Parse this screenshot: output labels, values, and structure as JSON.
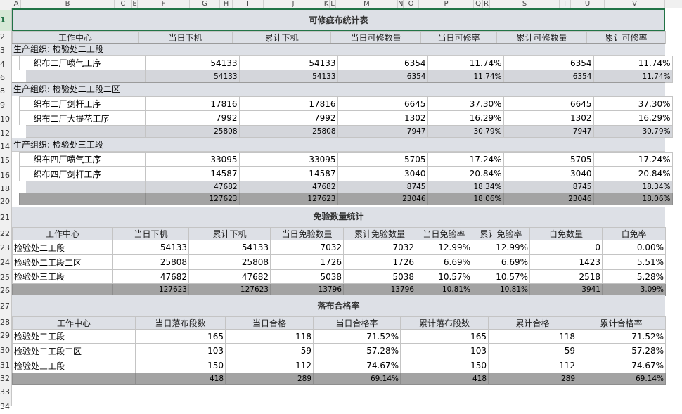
{
  "column_headers": [
    "A",
    "B",
    "C",
    "E",
    "F",
    "G",
    "H",
    "I",
    "J",
    "K",
    "L",
    "M",
    "N",
    "O",
    "P",
    "Q",
    "R",
    "S",
    "T",
    "U",
    "V"
  ],
  "row_headers": [
    "1",
    "2",
    "3",
    "4",
    "6",
    "8",
    "9",
    "10",
    "12",
    "14",
    "15",
    "16",
    "18",
    "20",
    "21",
    "22",
    "23",
    "24",
    "25",
    "26",
    "27",
    "28",
    "29",
    "30",
    "31",
    "32",
    "33",
    "34"
  ],
  "section1": {
    "title": "可修疵布统计表",
    "headers": [
      "工作中心",
      "当日下机",
      "累计下机",
      "当日可修数量",
      "当日可修率",
      "累计可修数量",
      "累计可修率"
    ],
    "groups": [
      {
        "label": "生产组织: 检验处二工段",
        "rows": [
          [
            "织布二厂喷气工序",
            "54133",
            "54133",
            "6354",
            "11.74%",
            "6354",
            "11.74%"
          ]
        ],
        "subtotal": [
          "",
          "54133",
          "54133",
          "6354",
          "11.74%",
          "6354",
          "11.74%"
        ]
      },
      {
        "label": "生产组织: 检验处二工段二区",
        "rows": [
          [
            "织布二厂剑杆工序",
            "17816",
            "17816",
            "6645",
            "37.30%",
            "6645",
            "37.30%"
          ],
          [
            "织布二厂大提花工序",
            "7992",
            "7992",
            "1302",
            "16.29%",
            "1302",
            "16.29%"
          ]
        ],
        "subtotal": [
          "",
          "25808",
          "25808",
          "7947",
          "30.79%",
          "7947",
          "30.79%"
        ]
      },
      {
        "label": "生产组织: 检验处三工段",
        "rows": [
          [
            "织布四厂喷气工序",
            "33095",
            "33095",
            "5705",
            "17.24%",
            "5705",
            "17.24%"
          ],
          [
            "织布四厂剑杆工序",
            "14587",
            "14587",
            "3040",
            "20.84%",
            "3040",
            "20.84%"
          ]
        ],
        "subtotal": [
          "",
          "47682",
          "47682",
          "8745",
          "18.34%",
          "8745",
          "18.34%"
        ]
      }
    ],
    "total": [
      "",
      "127623",
      "127623",
      "23046",
      "18.06%",
      "23046",
      "18.06%"
    ]
  },
  "section2": {
    "title": "免验数量统计",
    "headers": [
      "工作中心",
      "当日下机",
      "累计下机",
      "当日免验数量",
      "累计免验数量",
      "当日免验率",
      "累计免验率",
      "自免数量",
      "自免率"
    ],
    "rows": [
      [
        "检验处二工段",
        "54133",
        "54133",
        "7032",
        "7032",
        "12.99%",
        "12.99%",
        "0",
        "0.00%"
      ],
      [
        "检验处二工段二区",
        "25808",
        "25808",
        "1726",
        "1726",
        "6.69%",
        "6.69%",
        "1423",
        "5.51%"
      ],
      [
        "检验处三工段",
        "47682",
        "47682",
        "5038",
        "5038",
        "10.57%",
        "10.57%",
        "2518",
        "5.28%"
      ]
    ],
    "total": [
      "",
      "127623",
      "127623",
      "13796",
      "13796",
      "10.81%",
      "10.81%",
      "3941",
      "3.09%"
    ]
  },
  "section3": {
    "title": "落布合格率",
    "headers": [
      "工作中心",
      "当日落布段数",
      "当日合格",
      "当日合格率",
      "累计落布段数",
      "累计合格",
      "累计合格率"
    ],
    "rows": [
      [
        "检验处二工段",
        "165",
        "118",
        "71.52%",
        "165",
        "118",
        "71.52%"
      ],
      [
        "检验处二工段二区",
        "103",
        "59",
        "57.28%",
        "103",
        "59",
        "57.28%"
      ],
      [
        "检验处三工段",
        "150",
        "112",
        "74.67%",
        "150",
        "112",
        "74.67%"
      ]
    ],
    "total": [
      "",
      "418",
      "289",
      "69.14%",
      "418",
      "289",
      "69.14%"
    ]
  },
  "colors": {
    "header_bg": "#dde0e6",
    "subtotal_bg": "#d4d6db",
    "total_bg": "#a3a3a3",
    "selection": "#217346"
  }
}
